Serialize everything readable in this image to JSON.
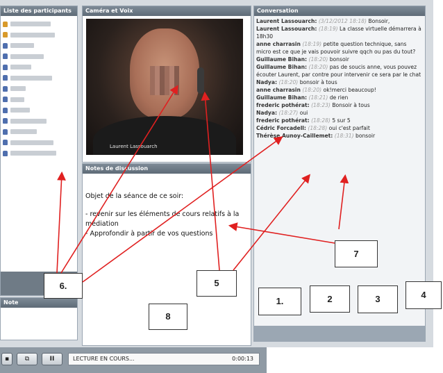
{
  "panels": {
    "participants_title": "Liste des participants",
    "camera_title": "Caméra et Voix",
    "notes_title": "Notes de discussion",
    "conversation_title": "Conversation",
    "note_title": "Note"
  },
  "participants": [
    {
      "role": "moderator"
    },
    {
      "role": "moderator"
    },
    {
      "role": "user"
    },
    {
      "role": "user"
    },
    {
      "role": "user"
    },
    {
      "role": "user"
    },
    {
      "role": "user"
    },
    {
      "role": "user"
    },
    {
      "role": "user"
    },
    {
      "role": "user"
    },
    {
      "role": "user"
    },
    {
      "role": "user"
    },
    {
      "role": "user"
    }
  ],
  "video": {
    "speaker_label": "Laurent Lassouarch"
  },
  "notes": {
    "line1": "Objet de la séance de ce soir:",
    "line2": "- revenir sur les éléments de cours relatifs à la médiation",
    "line3": "-  Approfondir à partir de vos questions"
  },
  "conversation": [
    {
      "who": "Laurent Lassouarch:",
      "time": "(3/12/2012 18:18)",
      "text": "Bonsoir,"
    },
    {
      "who": "Laurent Lassouarch:",
      "time": "(18:19)",
      "text": "La classe virtuelle démarrera à 18h30"
    },
    {
      "who": "anne charrasin",
      "time": "(18:19)",
      "text": "petite question technique, sans micro est ce que je vais pouvoir suivre qqch ou pas du tout?"
    },
    {
      "who": "Guillaume Bihan:",
      "time": "(18:20)",
      "text": "bonsoir"
    },
    {
      "who": "Guillaume Bihan:",
      "time": "(18:20)",
      "text": "pas de soucis anne, vous pouvez écouter Laurent, par contre pour intervenir ce sera par le chat"
    },
    {
      "who": "Nadya:",
      "time": "(18:20)",
      "text": "bonsoir à tous"
    },
    {
      "who": "anne charrasin",
      "time": "(18:20)",
      "text": "ok!merci beaucoup!"
    },
    {
      "who": "Guillaume Bihan:",
      "time": "(18:21)",
      "text": "de rien"
    },
    {
      "who": "frederic pothérat:",
      "time": "(18:23)",
      "text": "Bonsoir à tous"
    },
    {
      "who": "Nadya:",
      "time": "(18:27)",
      "text": "oui"
    },
    {
      "who": "frederic pothérat:",
      "time": "(18:28)",
      "text": "5 sur 5"
    },
    {
      "who": "Cédric Forcadell:",
      "time": "(18:28)",
      "text": "oui c'est parfait"
    },
    {
      "who": "Thérèse Aunoy-Caillemet:",
      "time": "(18:31)",
      "text": "bonsoir"
    }
  ],
  "bottom_bar": {
    "pause_label": "II",
    "status": "LECTURE EN COURS...",
    "time": "0:00:13"
  },
  "annotations": {
    "a1": "1.",
    "a2": "2",
    "a3": "3",
    "a4": "4",
    "a5": "5",
    "a6": "6.",
    "a7": "7",
    "a8": "8"
  },
  "colors": {
    "arrow": "#e02020",
    "panel_header": "#6a7784",
    "app_bg": "#d6dbe0"
  }
}
